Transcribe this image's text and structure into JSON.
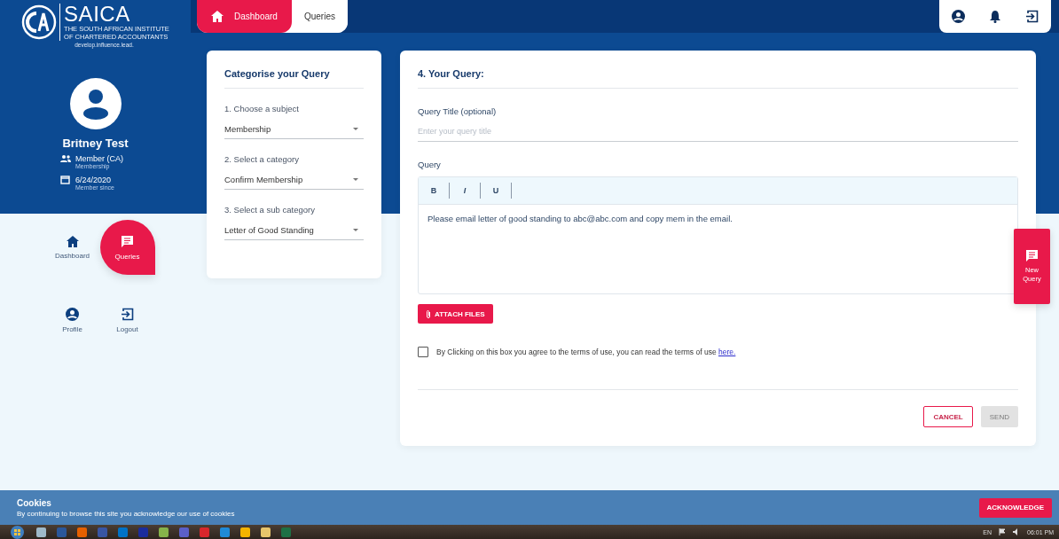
{
  "logo": {
    "name": "SAICA",
    "subtitle_lines": [
      "THE SOUTH AFRICAN INSTITUTE",
      "OF CHARTERED ACCOUNTANTS"
    ],
    "tagline": "develop.influence.lead."
  },
  "profile": {
    "name": "Britney Test",
    "details": [
      {
        "kind": "member",
        "value": "Member (CA)",
        "caption": "Membership"
      },
      {
        "kind": "date",
        "value": "6/24/2020",
        "caption": "Member since"
      }
    ]
  },
  "sidebar": {
    "items": [
      {
        "label": "Dashboard",
        "kind": "home",
        "selected": false
      },
      {
        "label": "Queries",
        "kind": "chat",
        "selected": true
      },
      {
        "label": "Profile",
        "kind": "user",
        "selected": false
      },
      {
        "label": "Logout",
        "kind": "logout",
        "selected": false
      }
    ]
  },
  "top_tabs": [
    {
      "label": "Dashboard",
      "kind": "home",
      "selected": true
    },
    {
      "label": "Queries",
      "kind": "plain",
      "selected": false
    }
  ],
  "categorise_card": {
    "title": "Categorise your Query",
    "fields": [
      {
        "label": "1. Choose a subject",
        "value": "Membership"
      },
      {
        "label": "2. Select a category",
        "value": "Confirm Membership"
      },
      {
        "label": "3. Select a sub category",
        "value": "Letter of Good Standing"
      }
    ]
  },
  "query_card": {
    "title": "4. Your Query:",
    "title_label": "Query Title (optional)",
    "title_placeholder": "Enter your query title",
    "query_label": "Query",
    "toolbar": [
      {
        "label": "B",
        "kind": "bold"
      },
      {
        "label": "I",
        "kind": "italic"
      },
      {
        "label": "U",
        "kind": "underline"
      }
    ],
    "query_text": "Please email letter of good standing to abc@abc.com and copy mem in the email.",
    "attach_button": "ATTACH FILES",
    "terms_checked": false,
    "terms_text": "By Clicking on this box you agree to the terms of use, you can read the terms of use",
    "terms_link": "here.",
    "cancel_button": "CANCEL",
    "send_button": {
      "label": "SEND",
      "disabled": true
    }
  },
  "new_query_button": "New Query",
  "cookie_bar": {
    "title": "Cookies",
    "text": "By continuing to browse this site you acknowledge our use of cookies",
    "button": "ACKNOWLEDGE"
  },
  "taskbar": {
    "language": "EN",
    "time": "06:01 PM"
  }
}
